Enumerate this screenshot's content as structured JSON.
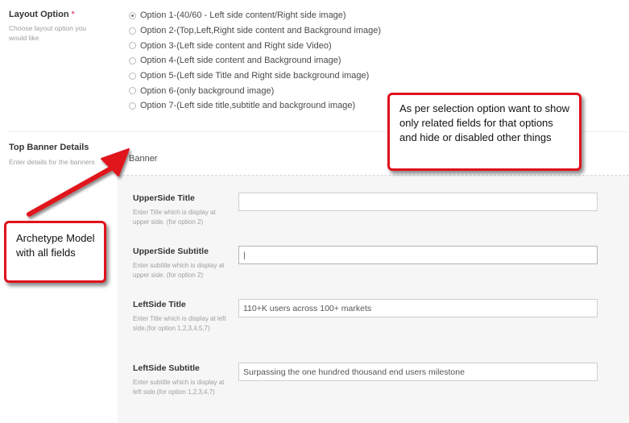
{
  "layout_option": {
    "label": "Layout Option",
    "required_mark": "*",
    "description": "Choose layout option you would like",
    "selected_index": 0,
    "options": [
      "Option 1-(40/60 - Left side content/Right side image)",
      "Option 2-(Top,Left,Right side content and Background image)",
      "Option 3-(Left side content and Right side Video)",
      "Option 4-(Left side content and Background image)",
      "Option 5-(Left side Title and Right side background image)",
      "Option 6-(only background image)",
      "Option 7-(Left side title,subtitle and background image)"
    ]
  },
  "top_banner": {
    "label": "Top Banner Details",
    "description": "Enter details for the banners",
    "fieldset_title": "Banner",
    "fields": [
      {
        "label": "UpperSide Title",
        "description": "Enter Title which is display at upper side. (for option 2)",
        "value": ""
      },
      {
        "label": "UpperSide Subtitle",
        "description": "Enter subtitle which is display at upper side. (for option 2)",
        "value": "|"
      },
      {
        "label": "LeftSide Title",
        "description": "Enter Title which is display at left side.(for option 1,2,3,4,5,7)",
        "value": "110+K users across 100+ markets"
      },
      {
        "label": "LeftSide Subtitle",
        "description": "Enter subtitle which is display at left side.(for option 1,2,3,4,7)",
        "value": "Surpassing the one hundred thousand end users milestone"
      }
    ]
  },
  "annotations": {
    "right_callout": "As per selection option want to show only related fields for that options and hide or disabled other things",
    "left_callout": "Archetype Model with all fields",
    "color": "#e0121c"
  }
}
